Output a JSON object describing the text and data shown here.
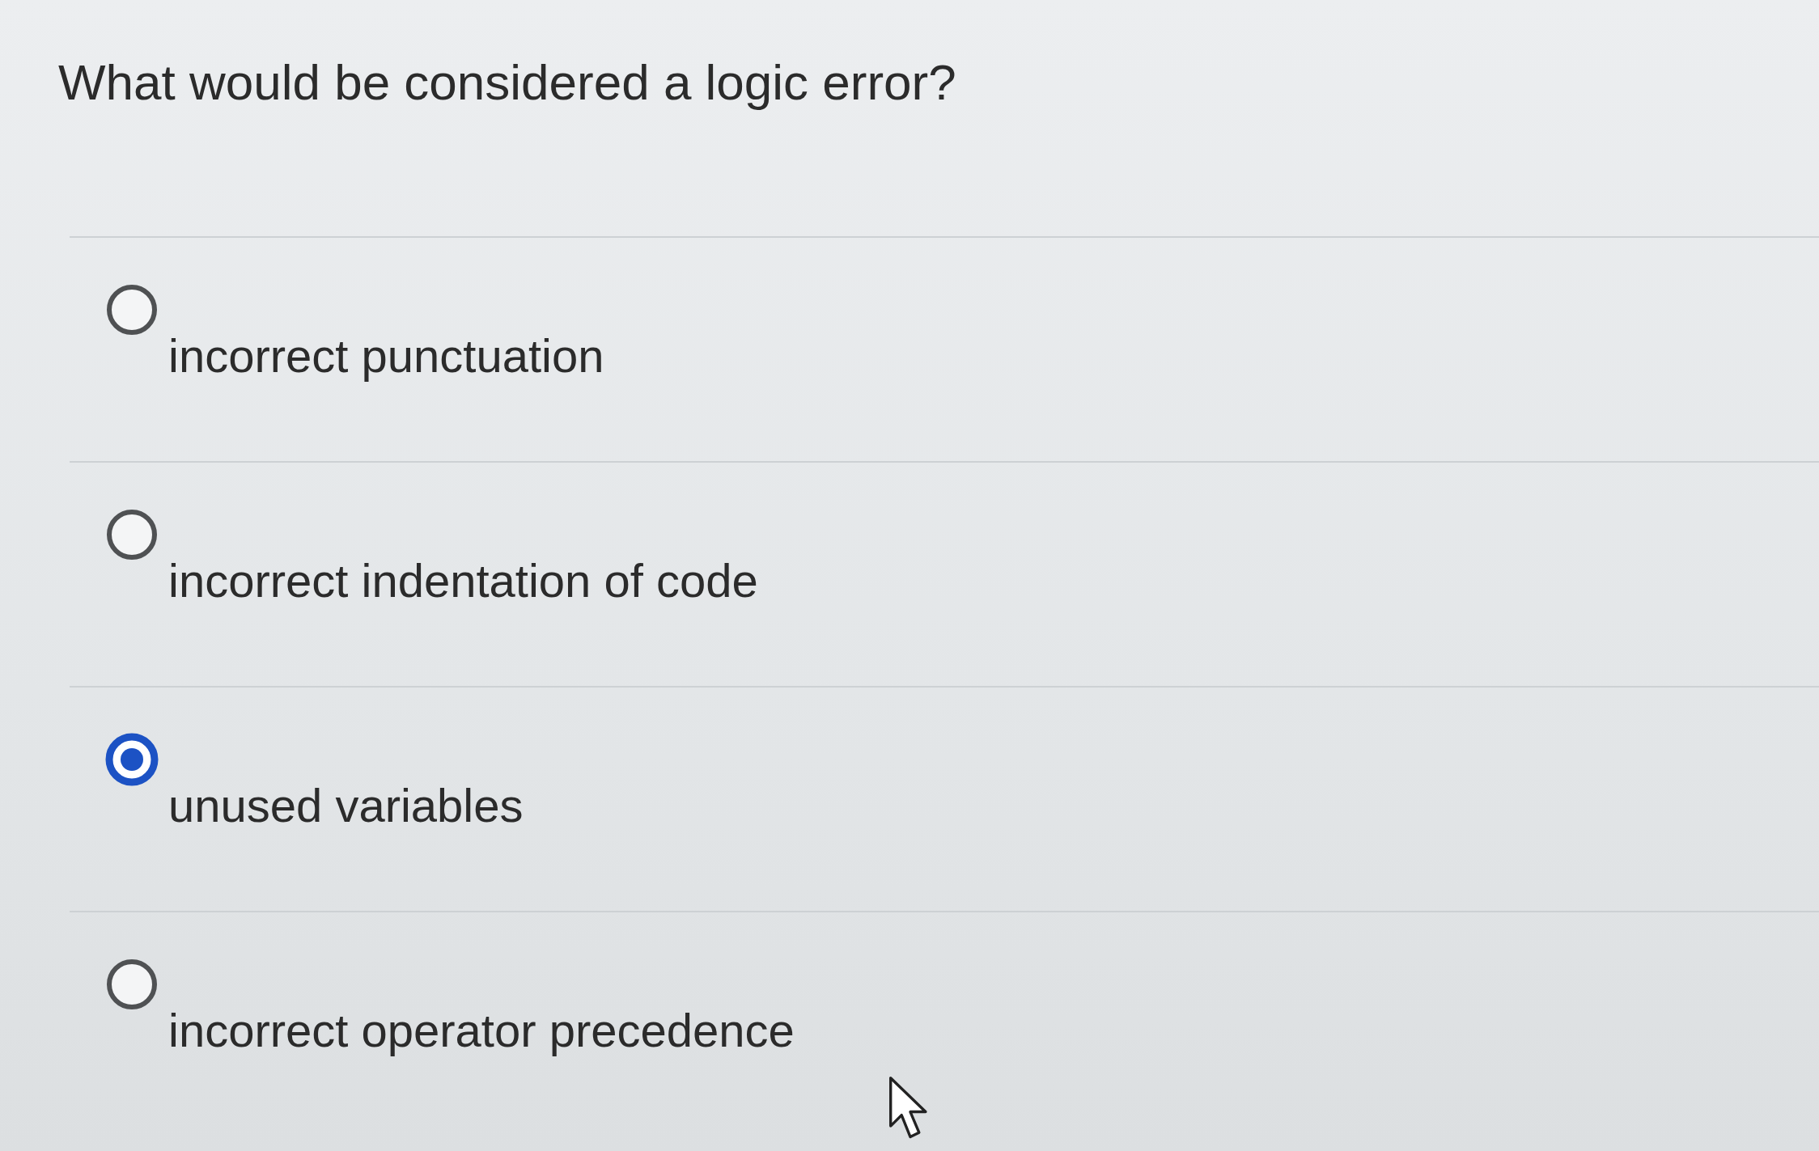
{
  "question": "What would be considered a logic error?",
  "options": [
    {
      "label": "incorrect punctuation",
      "selected": false
    },
    {
      "label": "incorrect indentation of code",
      "selected": false
    },
    {
      "label": "unused variables",
      "selected": true
    },
    {
      "label": "incorrect operator precedence",
      "selected": false
    }
  ]
}
